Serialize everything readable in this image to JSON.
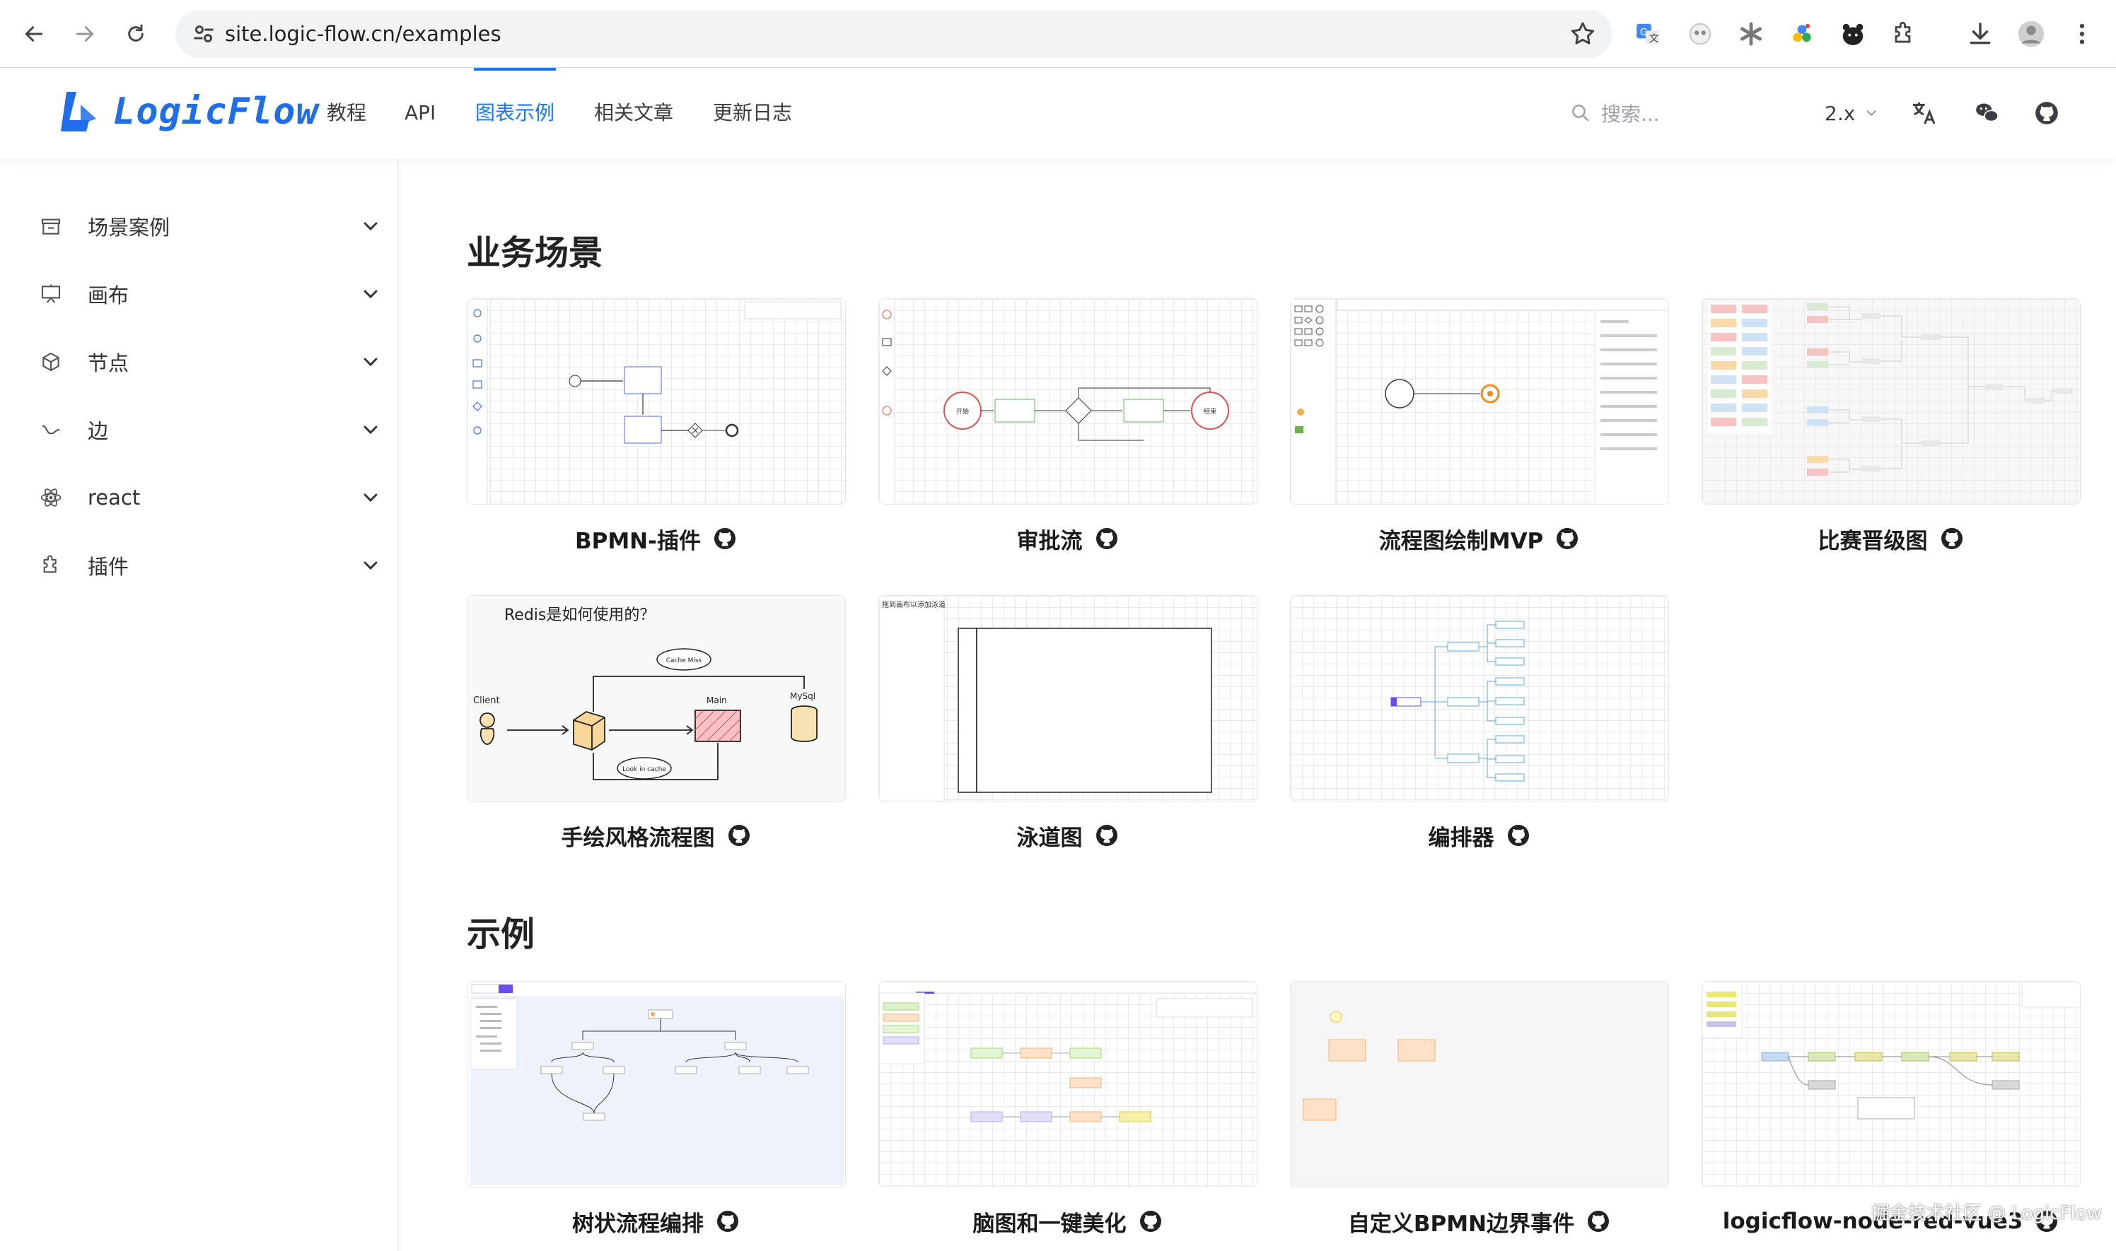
{
  "browser": {
    "url": "site.logic-flow.cn/examples"
  },
  "header": {
    "logo_text": "LogicFlow",
    "nav": [
      {
        "label": "教程"
      },
      {
        "label": "API"
      },
      {
        "label": "图表示例"
      },
      {
        "label": "相关文章"
      },
      {
        "label": "更新日志"
      }
    ],
    "search_placeholder": "搜索...",
    "version": "2.x"
  },
  "sidebar": {
    "items": [
      {
        "label": "场景案例",
        "icon": "store-icon"
      },
      {
        "label": "画布",
        "icon": "canvas-icon"
      },
      {
        "label": "节点",
        "icon": "cube-icon"
      },
      {
        "label": "边",
        "icon": "edge-icon"
      },
      {
        "label": "react",
        "icon": "react-icon"
      },
      {
        "label": "插件",
        "icon": "puzzle-icon"
      }
    ]
  },
  "sections": {
    "business": {
      "title": "业务场景",
      "cards": [
        {
          "title": "BPMN-插件"
        },
        {
          "title": "审批流"
        },
        {
          "title": "流程图绘制MVP"
        },
        {
          "title": "比赛晋级图"
        },
        {
          "title": "手绘风格流程图"
        },
        {
          "title": "泳道图"
        },
        {
          "title": "编排器"
        }
      ]
    },
    "examples": {
      "title": "示例",
      "cards": [
        {
          "title": "树状流程编排"
        },
        {
          "title": "脑图和一键美化"
        },
        {
          "title": "自定义BPMN边界事件"
        },
        {
          "title": "logicflow-node-red-vue3"
        }
      ]
    }
  },
  "thumbnails": {
    "approval": {
      "start": "开始",
      "end": "结束"
    },
    "handdrawn": {
      "title": "Redis是如何使用的？",
      "client": "Client",
      "main": "Main",
      "mysql": "MySql",
      "cache_miss": "Cache Miss",
      "look_in_cache": "Look in cache"
    },
    "swimlane": {
      "hint": "拖到画布以添加泳道"
    }
  },
  "watermark": "掘金技术社区 @ LogicFlow",
  "colors": {
    "accent": "#1677ff",
    "logo": "#1f6ee8"
  }
}
